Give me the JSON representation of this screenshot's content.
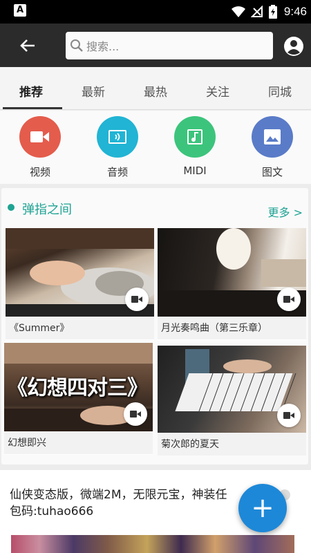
{
  "status_bar": {
    "time": "9:46",
    "notif_letter": "A"
  },
  "app_bar": {
    "search_placeholder": "搜索..."
  },
  "tabs": [
    {
      "label": "推荐",
      "active": true
    },
    {
      "label": "最新",
      "active": false
    },
    {
      "label": "最热",
      "active": false
    },
    {
      "label": "关注",
      "active": false
    },
    {
      "label": "同城",
      "active": false
    }
  ],
  "categories": [
    {
      "label": "视频",
      "icon": "video-camera-icon",
      "color": "#e45c4c"
    },
    {
      "label": "音频",
      "icon": "audio-icon",
      "color": "#21b4d4"
    },
    {
      "label": "MIDI",
      "icon": "midi-note-icon",
      "color": "#3cc47c"
    },
    {
      "label": "图文",
      "icon": "image-icon",
      "color": "#5a7bc8"
    }
  ],
  "section": {
    "title": "弹指之间",
    "more_label": "更多 >",
    "accent": "#1fa393",
    "items": [
      {
        "caption": "《Summer》"
      },
      {
        "caption": "月光奏鸣曲（第三乐章）"
      },
      {
        "caption": "幻想即兴",
        "overlay_text": "《幻想四对三》"
      },
      {
        "caption": "菊次郎的夏天"
      }
    ]
  },
  "ad": {
    "line1": "仙侠变态版，微端2M，无限元宝，神装任",
    "line2": "包码:tuhao666"
  },
  "fab": {
    "label": "+",
    "color": "#1d88d8"
  }
}
